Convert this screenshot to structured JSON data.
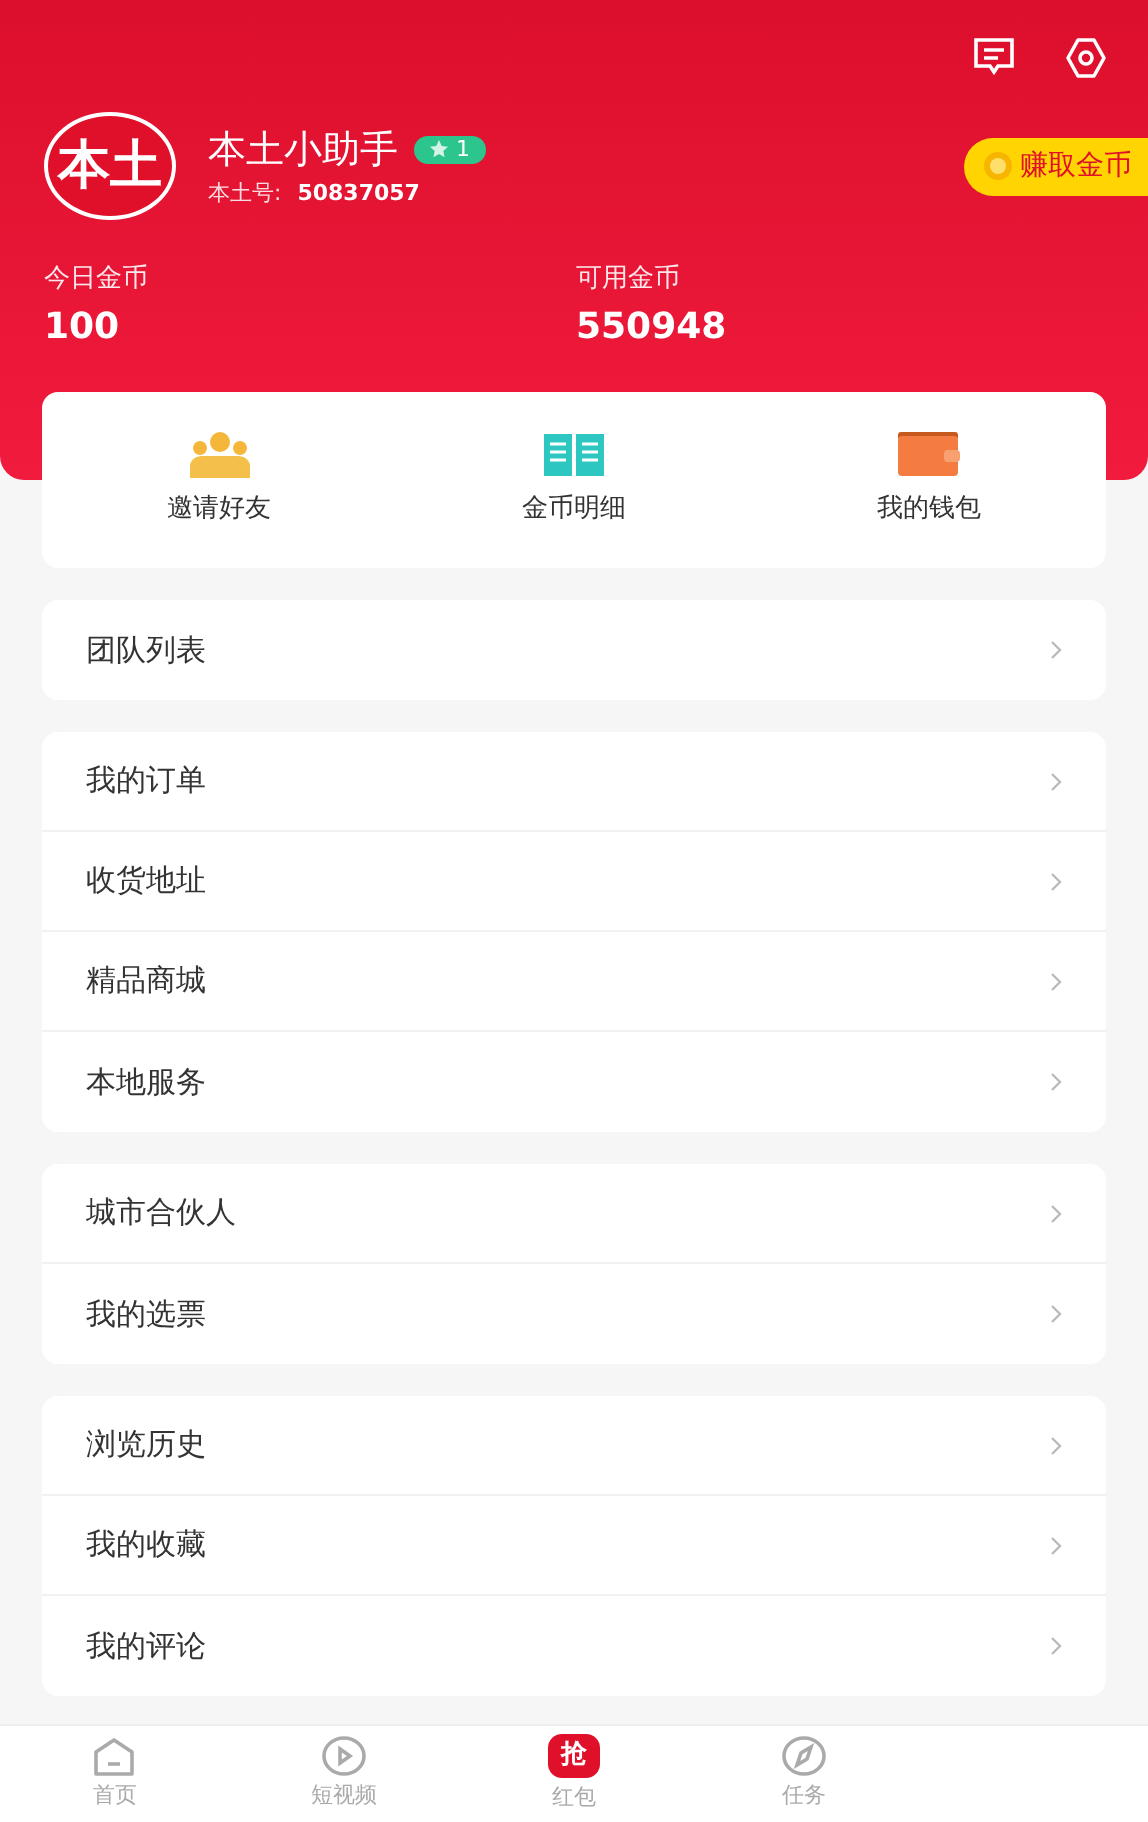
{
  "header": {
    "avatar_text": "本土",
    "username": "本土小助手",
    "level_badge": "1",
    "id_label": "本土号:",
    "id_value": "50837057",
    "earn_button": "赚取金币",
    "stats": [
      {
        "label": "今日金币",
        "value": "100"
      },
      {
        "label": "可用金币",
        "value": "550948"
      }
    ]
  },
  "shortcuts": [
    {
      "kind": "people",
      "label": "邀请好友"
    },
    {
      "kind": "book",
      "label": "金币明细"
    },
    {
      "kind": "wallet",
      "label": "我的钱包"
    }
  ],
  "menu_groups": [
    [
      "团队列表"
    ],
    [
      "我的订单",
      "收货地址",
      "精品商城",
      "本地服务"
    ],
    [
      "城市合伙人",
      "我的选票"
    ],
    [
      "浏览历史",
      "我的收藏",
      "我的评论"
    ]
  ],
  "tab_bar": [
    {
      "kind": "home",
      "label": "首页",
      "selected": false
    },
    {
      "kind": "video",
      "label": "短视频",
      "selected": false
    },
    {
      "kind": "redpacket",
      "label": "红包",
      "glyph": "抢",
      "selected": false
    },
    {
      "kind": "compass",
      "label": "任务",
      "selected": false
    }
  ]
}
